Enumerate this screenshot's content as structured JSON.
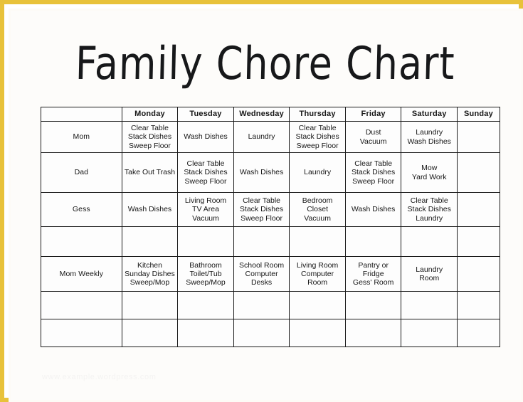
{
  "document": {
    "title": "Family Chore Chart",
    "border_color": "#e8c23a",
    "background_color": "#ffffff",
    "table_border_color": "#1b1b1b"
  },
  "table": {
    "corner_header": "",
    "day_headers": [
      "Monday",
      "Tuesday",
      "Wednesday",
      "Thursday",
      "Friday",
      "Saturday",
      "Sunday"
    ],
    "rows": [
      {
        "label": "Mom",
        "cells": [
          [
            "Clear Table",
            "Stack Dishes",
            "Sweep Floor"
          ],
          [
            "Wash Dishes"
          ],
          [
            "Laundry"
          ],
          [
            "Clear Table",
            "Stack Dishes",
            "Sweep Floor"
          ],
          [
            "Dust",
            "Vacuum"
          ],
          [
            "Laundry",
            "Wash Dishes"
          ],
          []
        ]
      },
      {
        "label": "Dad",
        "cells": [
          [
            "Take Out Trash"
          ],
          [
            "Clear Table",
            "Stack Dishes",
            "Sweep Floor"
          ],
          [
            "Wash Dishes"
          ],
          [
            "Laundry"
          ],
          [
            "Clear Table",
            "Stack Dishes",
            "Sweep Floor"
          ],
          [
            "Mow",
            "Yard Work"
          ],
          []
        ]
      },
      {
        "label": "Gess",
        "cells": [
          [
            "Wash Dishes"
          ],
          [
            "Living Room",
            "TV Area",
            "Vacuum"
          ],
          [
            "Clear Table",
            "Stack Dishes",
            "Sweep Floor"
          ],
          [
            "Bedroom",
            "Closet",
            "Vacuum"
          ],
          [
            "Wash Dishes"
          ],
          [
            "Clear Table",
            "Stack Dishes",
            "Laundry"
          ],
          []
        ]
      },
      {
        "label": "",
        "cells": [
          [],
          [],
          [],
          [],
          [],
          [],
          []
        ]
      },
      {
        "label": "Mom Weekly",
        "cells": [
          [
            "Kitchen",
            "Sunday Dishes",
            "Sweep/Mop"
          ],
          [
            "Bathroom",
            "Toilet/Tub",
            "Sweep/Mop"
          ],
          [
            "School Room",
            "Computer",
            "Desks"
          ],
          [
            "Living Room",
            "Computer",
            "Room"
          ],
          [
            "Pantry or",
            "Fridge",
            "Gess' Room"
          ],
          [
            "Laundry",
            "Room"
          ],
          []
        ]
      },
      {
        "label": "",
        "cells": [
          [],
          [],
          [],
          [],
          [],
          [],
          []
        ]
      },
      {
        "label": "",
        "cells": [
          [],
          [],
          [],
          [],
          [],
          [],
          []
        ]
      }
    ]
  },
  "watermark": {
    "text": "www.example.wordpress.com"
  }
}
